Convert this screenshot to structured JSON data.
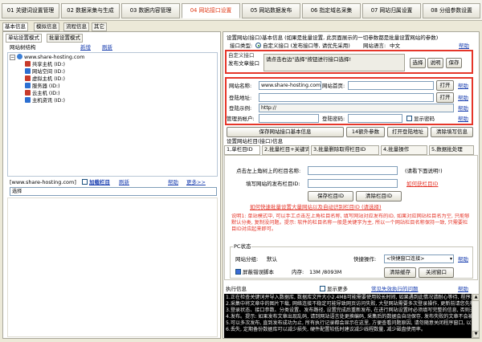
{
  "top_tabs": [
    {
      "label": "01 关键词设置管理",
      "active": false
    },
    {
      "label": "02 数据采集与生成",
      "active": false
    },
    {
      "label": "03 数据内容管理",
      "active": false
    },
    {
      "label": "04 网站接口设置",
      "active": true
    },
    {
      "label": "05 网站数据发布",
      "active": false
    },
    {
      "label": "06 指定域名采集",
      "active": false
    },
    {
      "label": "07 网站归属设置",
      "active": false
    },
    {
      "label": "08 分组参数设置",
      "active": false
    }
  ],
  "left_tabs": [
    "基本信息",
    "模拟信息",
    "流程信息",
    "其它"
  ],
  "left_sub_tabs": [
    "单站设置模式",
    "批量设置模式"
  ],
  "site_tree": {
    "label": "网站树结构",
    "new_link": "新增",
    "refresh_link": "刷新",
    "root": "www.share-hosting.com",
    "children": [
      {
        "label": "共享主机 (ID:)",
        "color": "#c73b2b"
      },
      {
        "label": "网站空间 (ID:)",
        "color": "#2c6fd1"
      },
      {
        "label": "虚拟主机 (ID:)",
        "color": "#c73b2b"
      },
      {
        "label": "服务器 (ID:)",
        "color": "#2c6fd1"
      },
      {
        "label": "云主机 (ID:)",
        "color": "#c73b2b"
      },
      {
        "label": "主机资讯 (ID:)",
        "color": "#2c6fd1"
      }
    ]
  },
  "left_footer": {
    "site_label": "[www.share-hosting.com]",
    "add_column": "加载栏目",
    "refresh": "刷新",
    "help": "帮助",
    "more": "更多>>",
    "select_button": "选择"
  },
  "interface": {
    "title": "设置网站(接口)基本信息 (如果是批量设置, 此页面展示的一切参数都是批量设置网站的参数)",
    "help": "帮助",
    "type_label": "接口类型:",
    "type_option": "自定义接口 (发布接口等, 请优先采用)",
    "site_lang_label": "网站语言:",
    "site_lang": "中文",
    "custom_interface_label": "自定义接口",
    "publish_label": "发布文章接口",
    "publish_value": "请点击右边\"选择\"按钮进行接口选择!",
    "select_btn": "选择",
    "desc_btn": "说明",
    "save_btn": "保存"
  },
  "site_info": {
    "name_label": "网站名称:",
    "name_value": "www.share-hosting.com",
    "home_label": "网站首页:",
    "home_value": "",
    "open_btn": "打开",
    "login_label": "登陆地址:",
    "login_value": "",
    "example_label": "登陆示例:",
    "example_value": "http://",
    "admin_label": "管理员帐户:",
    "admin_value": "",
    "password_label": "登陆密码:",
    "password_value": "",
    "show_password": "显示密码",
    "help": "帮助"
  },
  "action_buttons": [
    "保存网站接口基本信息",
    "14额外参数",
    "打开登陆地址",
    "清除填写信息"
  ],
  "column_section": {
    "title": "设置网站栏目(接口)信息",
    "tabs": [
      "1,单栏目ID",
      "2,批量栏目+关键词",
      "3,批量删除取得栏目ID",
      "4,批量操作",
      "5,数据批处理"
    ],
    "left_col_label": "点击左上角树上的栏目名称:",
    "left_col_value": "",
    "left_col_hint": "(请看下面说明!)",
    "publish_col_label": "填写网站的发布栏目ID:",
    "publish_col_value": "",
    "get_col_link": "如何获栏目ID",
    "save_col_btn": "保存栏目ID",
    "clear_col_btn": "清除栏目ID",
    "red_link": "如何快速批量设置大量网站以及自动识别栏目ID (请选择)",
    "instruction": "说明1: 单站模式中, 可以手工点击左上角栏目名称, 填写网站对应发布的ID, 如果对应网站栏目名为空, 只能够默认分类, 复制没问题。提示: 软件的栏目名称一般是关键字为主, 所以一个网站栏目名称保持一致, 只需要栏目ID对应起来即可。"
  },
  "pc_status": {
    "title": "PC状态",
    "group_label": "网站分组:",
    "group_value": "默认",
    "quick_label": "快捷操作:",
    "quick_value": "<快捷窗口连接>",
    "help": "帮助",
    "screen_saver": "屏蔽错误脚本",
    "memory_label": "内存:",
    "memory_value": "13M /8093M",
    "clear_cache_btn": "清除缓存",
    "close_window_btn": "关闭窗口"
  },
  "execution": {
    "title": "执行信息",
    "show_more": "显示更多",
    "bottom_link": "常见失效执行的问题",
    "help": "帮助",
    "log_lines": [
      "1.正在检查关键词并导入数据库, 数据库文件大小2.4MB可能需要使用较长时间, 如果遇到此情况请耐心等待, 程序正在处理中。",
      "2.采集中将文章中的图片下载, 网络连接不稳定可能导致网页访问失败, 大型网站需要多次登录操作, 更新前请您先检查网站的",
      "3.登录状态、接口参数、分类设置、发布路径, 设置完成后重新发布, 在进行网站设置时必须填写完整的信息, 否则无法正常",
      "4.发布。提示: 如果发布文章出现乱码, 请到网站语言处更换编码, 采集后的数据会自动保存, 发布失败的文章不会被删除,",
      "5.可以多次发布, 直到发布成功为止, 所有执行记录都会显示在这里, 方便查看问题原因, 请勿随意关闭程序窗口, 以免数据",
      "6.丢失, 定期备份数据库可以减少损失, 硬件配置较低时建议减少线程数量, 减少磁盘使用率。"
    ]
  }
}
